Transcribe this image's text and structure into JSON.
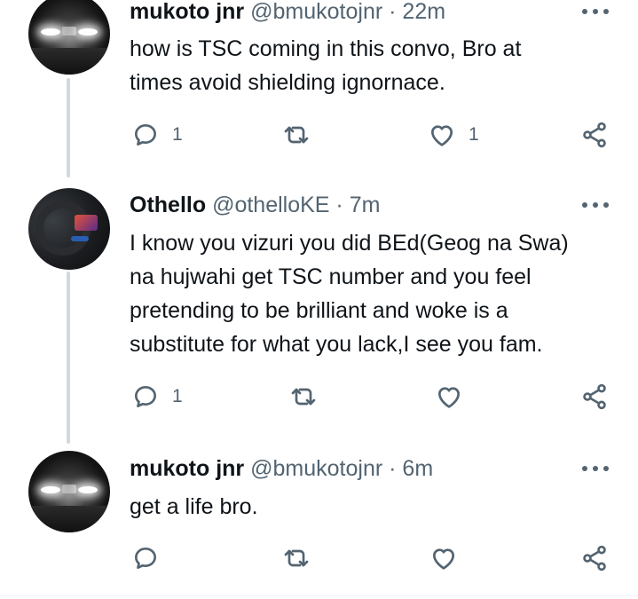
{
  "tweets": [
    {
      "author_name": "mukoto jnr",
      "handle": "@bmukotojnr",
      "separator": "·",
      "time": "22m",
      "avatar": "car-headlights-avatar",
      "lines": [
        "how is TSC coming in this convo, Bro at",
        "times avoid shielding ignornace."
      ],
      "reply_count": "1",
      "retweet_count": "",
      "like_count": "1"
    },
    {
      "author_name": "Othello",
      "handle": "@othelloKE",
      "separator": "·",
      "time": "7m",
      "avatar": "car-dashboard-avatar",
      "lines": [
        "I know you vizuri you did BEd(Geog na Swa)",
        "na hujwahi get TSC number and you feel",
        "pretending to be brilliant and woke is a",
        "substitute for what you lack,I see you fam."
      ],
      "reply_count": "1",
      "retweet_count": "",
      "like_count": ""
    },
    {
      "author_name": "mukoto jnr",
      "handle": "@bmukotojnr",
      "separator": "·",
      "time": "6m",
      "avatar": "car-headlights-avatar",
      "lines": [
        "get a life bro."
      ],
      "reply_count": "",
      "retweet_count": "",
      "like_count": ""
    }
  ],
  "icons": {
    "reply": "reply-icon",
    "retweet": "retweet-icon",
    "like": "like-icon",
    "share": "share-icon",
    "more": "more-options-icon"
  },
  "colors": {
    "text_primary": "#0f1419",
    "text_secondary": "#536471",
    "thread_line": "#cfd9de",
    "background": "#ffffff"
  }
}
